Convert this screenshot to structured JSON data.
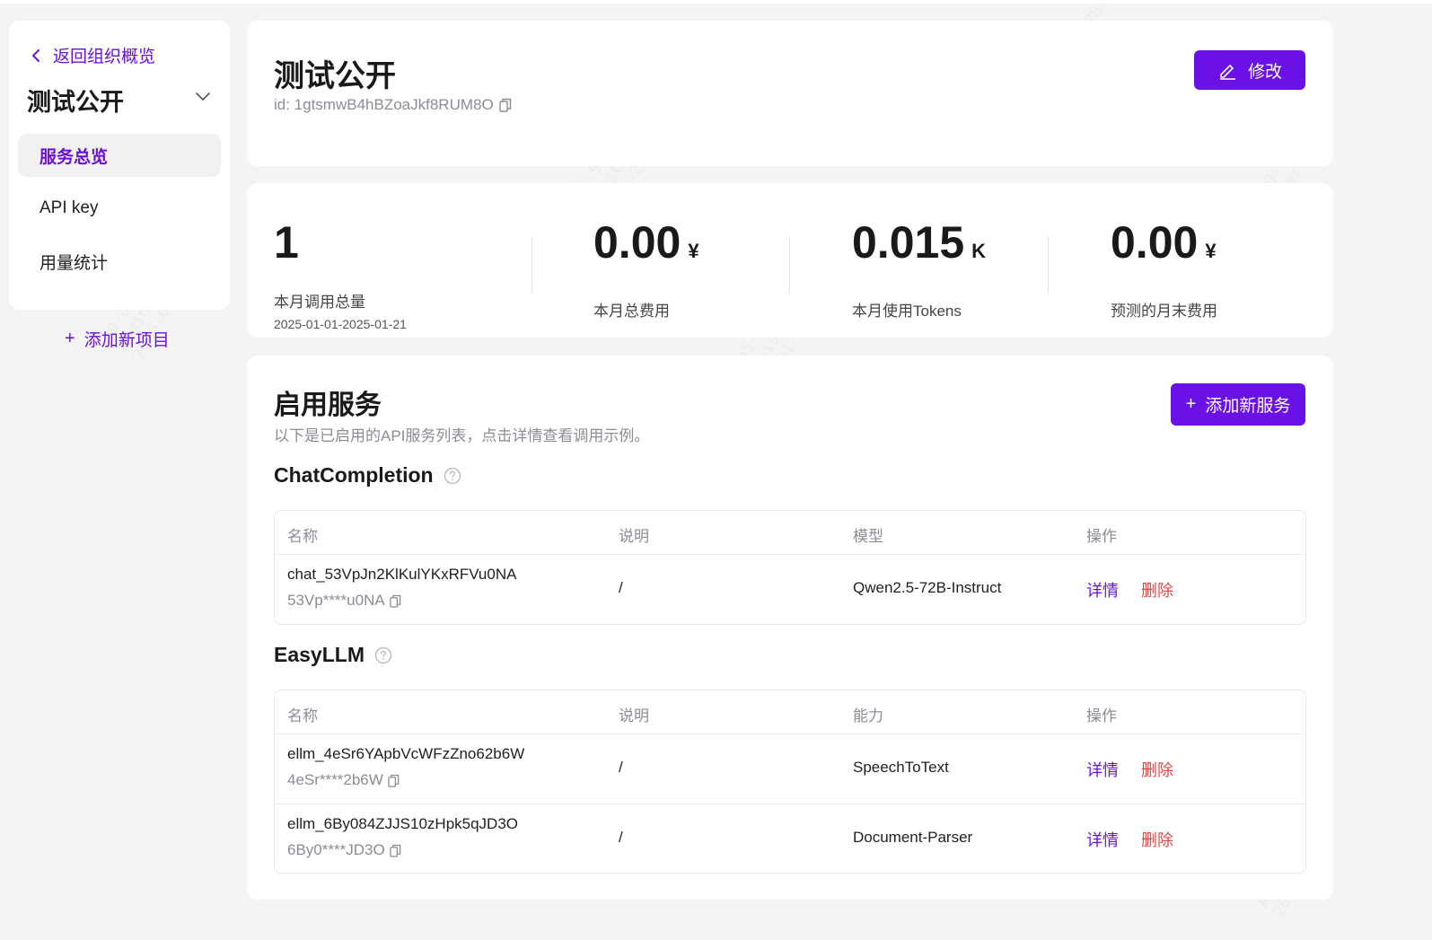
{
  "sidebar": {
    "back_label": "返回组织概览",
    "project_name": "测试公开",
    "nav": [
      {
        "label": "服务总览",
        "active": true
      },
      {
        "label": "API key",
        "active": false
      },
      {
        "label": "用量统计",
        "active": false
      }
    ],
    "add_project_label": "添加新项目"
  },
  "header": {
    "title": "测试公开",
    "id_text": "id: 1gtsmwB4hBZoaJkf8RUM8O",
    "edit_label": "修改"
  },
  "stats": [
    {
      "value": "1",
      "unit": "",
      "label": "本月调用总量",
      "sub": "2025-01-01-2025-01-21"
    },
    {
      "value": "0.00",
      "unit": "¥",
      "label": "本月总费用",
      "sub": ""
    },
    {
      "value": "0.015",
      "unit": "K",
      "label": "本月使用Tokens",
      "sub": ""
    },
    {
      "value": "0.00",
      "unit": "¥",
      "label": "预测的月末费用",
      "sub": ""
    }
  ],
  "services": {
    "title": "启用服务",
    "description": "以下是已启用的API服务列表，点击详情查看调用示例。",
    "add_label": "添加新服务",
    "groups": [
      {
        "title": "ChatCompletion",
        "columns": [
          "名称",
          "说明",
          "模型",
          "操作"
        ],
        "rows": [
          {
            "name": "chat_53VpJn2KlKulYKxRFVu0NA",
            "key": "53Vp****u0NA",
            "desc": "/",
            "third": "Qwen2.5-72B-Instruct",
            "detail": "详情",
            "delete": "删除"
          }
        ]
      },
      {
        "title": "EasyLLM",
        "columns": [
          "名称",
          "说明",
          "能力",
          "操作"
        ],
        "rows": [
          {
            "name": "ellm_4eSr6YApbVcWFzZno62b6W",
            "key": "4eSr****2b6W",
            "desc": "/",
            "third": "SpeechToText",
            "detail": "详情",
            "delete": "删除"
          },
          {
            "name": "ellm_6By084ZJJS10zHpk5qJD3O",
            "key": "6By0****JD3O",
            "desc": "/",
            "third": "Document-Parser",
            "detail": "详情",
            "delete": "删除"
          }
        ]
      }
    ]
  },
  "watermark": [
    "00-a5-54-90-76-94",
    "Administrator",
    "2025-01-21"
  ],
  "colors": {
    "accent": "#6a11e8",
    "danger": "#e54848",
    "muted": "#8a8d93",
    "background": "#f4f4f5"
  },
  "icons": [
    "chevron-left-icon",
    "chevron-down-icon",
    "copy-icon",
    "edit-icon",
    "plus-icon",
    "help-icon"
  ]
}
